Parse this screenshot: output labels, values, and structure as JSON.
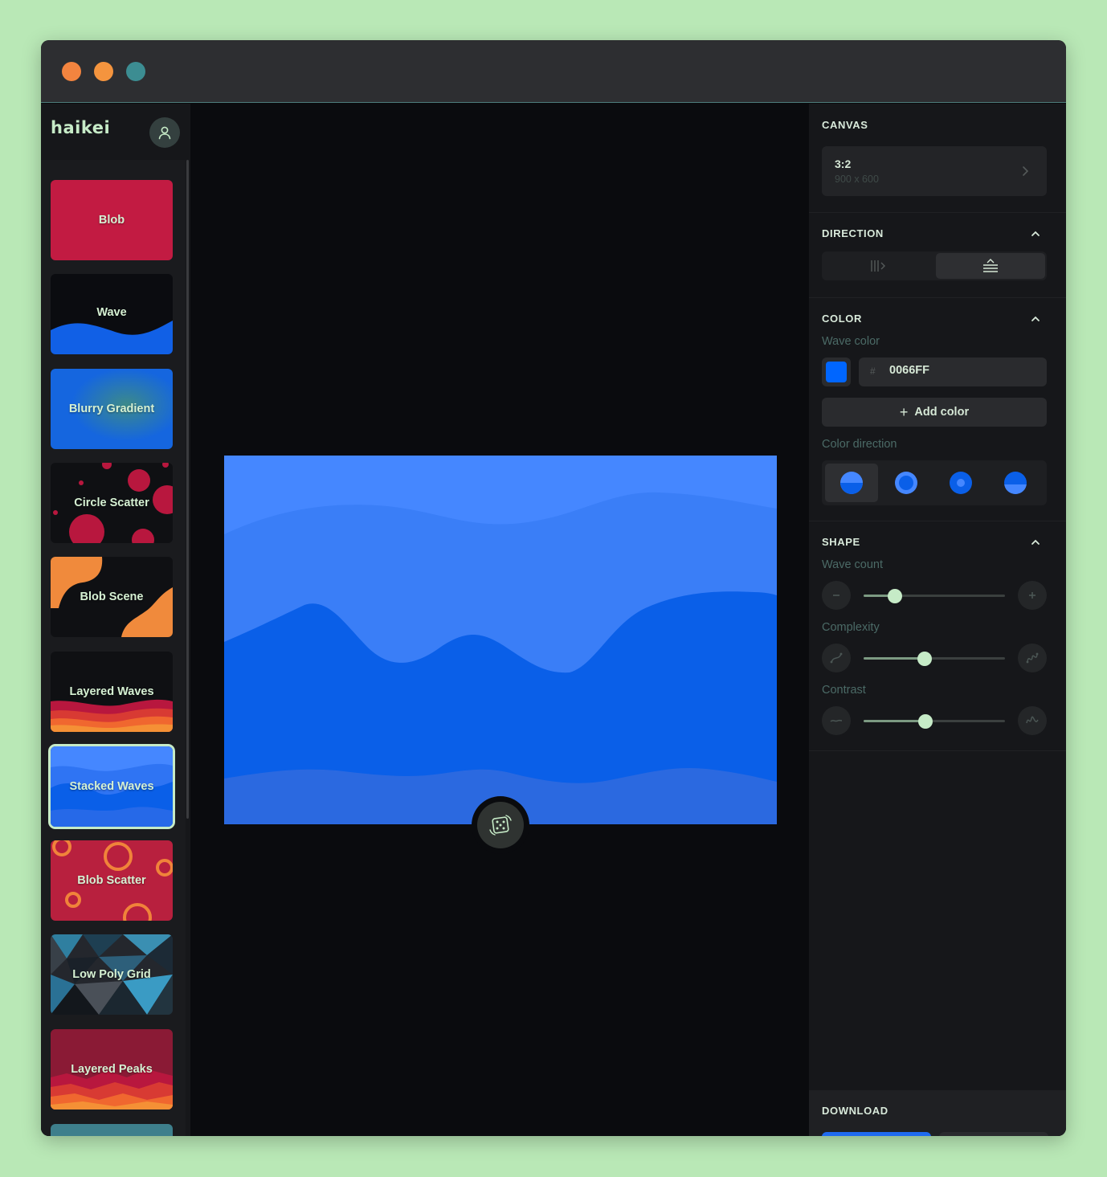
{
  "app": {
    "brand": "haikei"
  },
  "sidebar": {
    "items": [
      {
        "label": "Blob"
      },
      {
        "label": "Wave"
      },
      {
        "label": "Blurry Gradient"
      },
      {
        "label": "Circle Scatter"
      },
      {
        "label": "Blob Scene"
      },
      {
        "label": "Layered Waves"
      },
      {
        "label": "Stacked Waves",
        "selected": true
      },
      {
        "label": "Blob Scatter"
      },
      {
        "label": "Low Poly Grid"
      },
      {
        "label": "Layered Peaks"
      }
    ]
  },
  "panel": {
    "canvas": {
      "title": "CANVAS",
      "ratio": "3:2",
      "size": "900 x 600"
    },
    "direction": {
      "title": "DIRECTION",
      "selected": "vertical-stack"
    },
    "color": {
      "title": "COLOR",
      "wave_color_label": "Wave color",
      "hash": "#",
      "hex": "0066FF",
      "swatch": "#0066FF",
      "add_color": "Add color",
      "color_direction_label": "Color direction"
    },
    "shape": {
      "title": "SHAPE",
      "wave_count_label": "Wave count",
      "wave_count_value": 0.22,
      "complexity_label": "Complexity",
      "complexity_value": 0.43,
      "contrast_label": "Contrast",
      "contrast_value": 0.44
    },
    "download": {
      "title": "DOWNLOAD"
    }
  },
  "colors": {
    "accent": "#C6EBC7",
    "wave_primary": "#0066FF",
    "background": "#0A0B0E"
  }
}
